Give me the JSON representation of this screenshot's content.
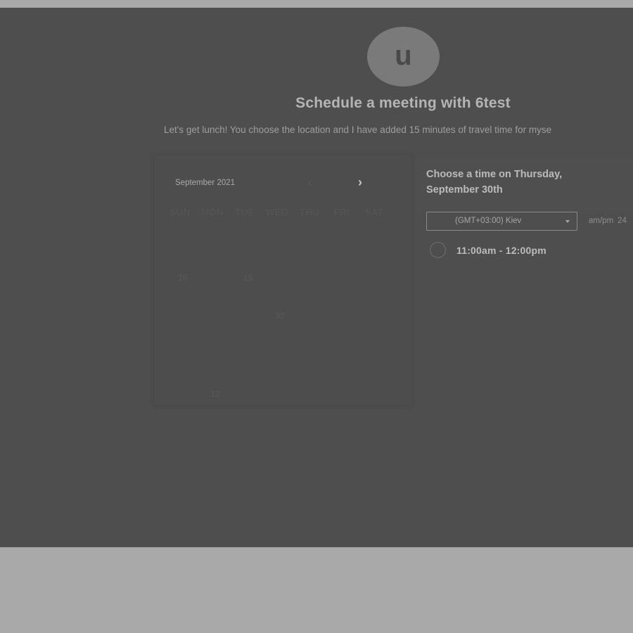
{
  "host": {
    "avatar_initial": "u"
  },
  "header": {
    "title": "Schedule a meeting with 6test",
    "description": "Let's get lunch! You choose the location and I have added 15 minutes of travel time for myse"
  },
  "calendar": {
    "month_label": "September 2021",
    "prev_icon": "chevron-left-icon",
    "next_icon": "chevron-right-icon",
    "prev_glyph": "‹",
    "next_glyph": "›",
    "weekdays": [
      "SUN",
      "MON",
      "TUE",
      "WED",
      "THU",
      "FRI",
      "SAT"
    ],
    "visible_days": [
      "16",
      "15",
      "30",
      "12"
    ]
  },
  "time_panel": {
    "heading": "Choose a time on Thursday, September 30th",
    "timezone": "(GMT+03:00) Kiev",
    "format_ampm": "am/pm",
    "format_24": "24",
    "slots": [
      {
        "label": "11:00am - 12:00pm"
      }
    ]
  }
}
